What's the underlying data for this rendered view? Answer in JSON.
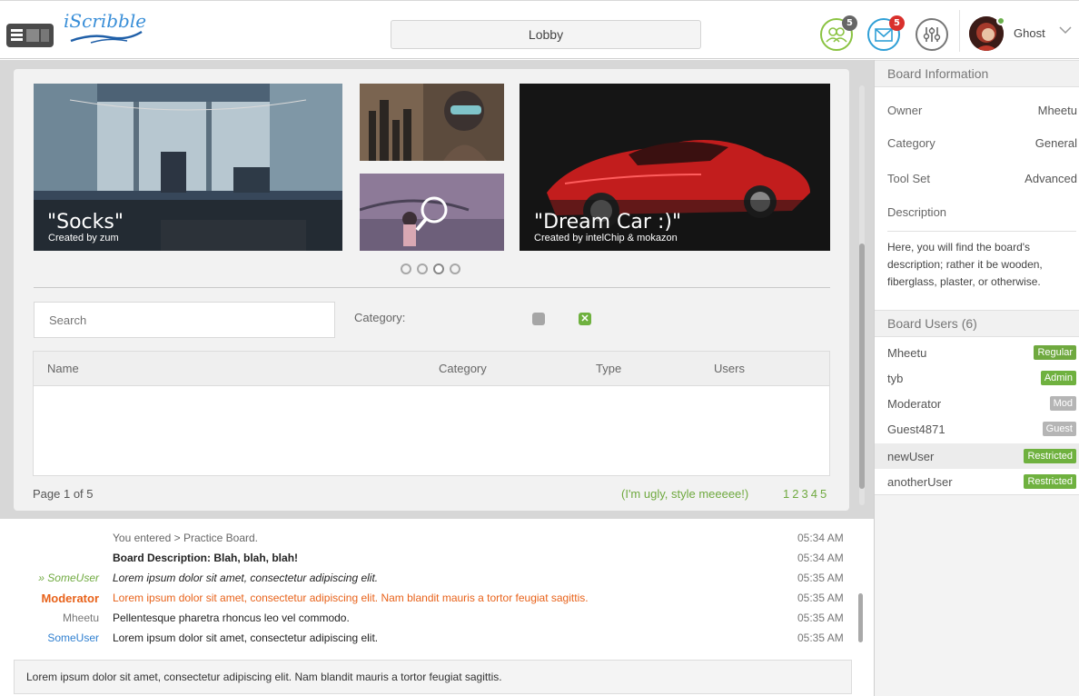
{
  "app": {
    "logo_text": "iScribble",
    "lobby_title": "Lobby"
  },
  "header": {
    "friends_count": "5",
    "mail_count": "5",
    "username": "Ghost",
    "colors": {
      "friends": "#8ac341",
      "mail": "#2f9fd6",
      "mail_badge": "#d9302c"
    }
  },
  "featured": {
    "slides": [
      {
        "title": "\"Socks\"",
        "subtitle": "Created by zum"
      },
      {
        "title": "\"Dream Car :)\"",
        "subtitle": "Created by intelChip & mokazon"
      }
    ],
    "dots_total": 4,
    "dots_active": 3
  },
  "filters": {
    "search_placeholder": "Search",
    "category_label": "Category:",
    "checkbox_checked_mark": "✕"
  },
  "table": {
    "columns": [
      "Name",
      "Category",
      "Type",
      "Users"
    ]
  },
  "pagination": {
    "info": "Page 1 of 5",
    "note": "(I'm ugly, style meeeee!)",
    "pages": [
      "1",
      "2",
      "3",
      "4",
      "5"
    ]
  },
  "chat": {
    "messages": [
      {
        "nick": "",
        "text": "You entered > Practice Board.",
        "time": "05:34 AM",
        "style": "system"
      },
      {
        "nick": "",
        "text": "Board Description: Blah, blah, blah!",
        "time": "05:34 AM",
        "style": "bold"
      },
      {
        "nick": "» SomeUser",
        "text": "Lorem ipsum dolor sit amet, consectetur adipiscing elit.",
        "time": "05:35 AM",
        "style": "action"
      },
      {
        "nick": "Moderator",
        "text": "Lorem ipsum dolor sit amet, consectetur adipiscing elit. Nam blandit mauris a tortor feugiat sagittis.",
        "time": "05:35 AM",
        "style": "moderator"
      },
      {
        "nick": "Mheetu",
        "text": "Pellentesque pharetra rhoncus leo vel commodo.",
        "time": "05:35 AM",
        "style": "normal"
      },
      {
        "nick": "SomeUser",
        "text": "Lorem ipsum dolor sit amet, consectetur adipiscing elit.",
        "time": "05:35 AM",
        "style": "blue"
      }
    ],
    "input_value": "Lorem ipsum dolor sit amet, consectetur adipiscing elit. Nam blandit mauris a tortor feugiat sagittis."
  },
  "sidebar": {
    "board_info_title": "Board Information",
    "info": [
      {
        "key": "Owner",
        "value": "Mheetu"
      },
      {
        "key": "Category",
        "value": "General"
      },
      {
        "key": "Tool Set",
        "value": "Advanced"
      },
      {
        "key": "Description",
        "value": ""
      }
    ],
    "description": "Here, you will find the board's description; rather it be wooden, fiberglass, plaster, or otherwise.",
    "users_title": "Board Users (6)",
    "users": [
      {
        "name": "Mheetu",
        "role": "Regular",
        "color": "#6fa93f"
      },
      {
        "name": "tyb",
        "role": "Admin",
        "color": "#6fb13f"
      },
      {
        "name": "Moderator",
        "role": "Mod",
        "color": "#b5b5b5"
      },
      {
        "name": "Guest4871",
        "role": "Guest",
        "color": "#b5b5b5"
      },
      {
        "name": "newUser",
        "role": "Restricted",
        "color": "#6fb13f"
      },
      {
        "name": "anotherUser",
        "role": "Restricted",
        "color": "#6fb13f"
      }
    ]
  }
}
